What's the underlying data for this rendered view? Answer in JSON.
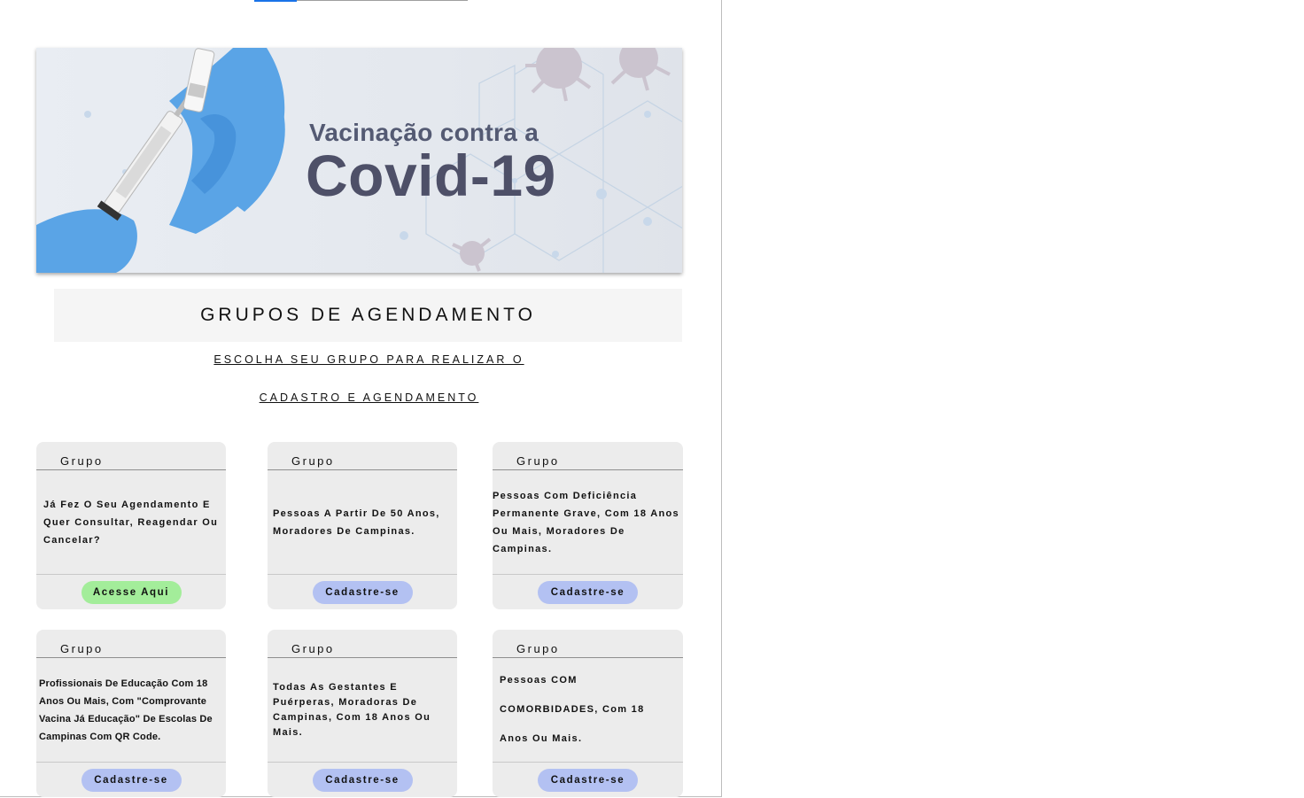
{
  "banner": {
    "line1": "Vacinação contra a",
    "line2": "Covid-19"
  },
  "section": {
    "title": "GRUPOS DE AGENDAMENTO",
    "subtitle_line1": "ESCOLHA SEU GRUPO PARA REALIZAR O",
    "subtitle_line2": "CADASTRO E AGENDAMENTO"
  },
  "cards": [
    {
      "header": "Grupo",
      "text": "Já Fez O Seu Agendamento E Quer Consultar, Reagendar Ou Cancelar?",
      "button": "Acesse Aqui"
    },
    {
      "header": "Grupo",
      "text": "Pessoas A Partir De 50 Anos, Moradores De Campinas.",
      "button": "Cadastre-se"
    },
    {
      "header": "Grupo",
      "text": "Pessoas Com Deficiência Permanente Grave, Com 18 Anos Ou Mais, Moradores De Campinas.",
      "button": "Cadastre-se"
    },
    {
      "header": "Grupo",
      "text": "Profissionais De Educação Com 18 Anos Ou Mais, Com \"Comprovante Vacina Já Educação\" De Escolas De Campinas Com QR Code.",
      "button": "Cadastre-se"
    },
    {
      "header": "Grupo",
      "text": "Todas As Gestantes E Puérperas, Moradoras De Campinas, Com 18 Anos Ou Mais.",
      "button": "Cadastre-se"
    },
    {
      "header": "Grupo",
      "text": "Pessoas COM COMORBIDADES, Com 18 Anos Ou Mais.",
      "button": "Cadastre-se"
    }
  ],
  "colors": {
    "access_button": "#a3ed9a",
    "register_button": "#b3c1f2",
    "card_background": "#ececec",
    "title_background": "#f5f5f5"
  }
}
